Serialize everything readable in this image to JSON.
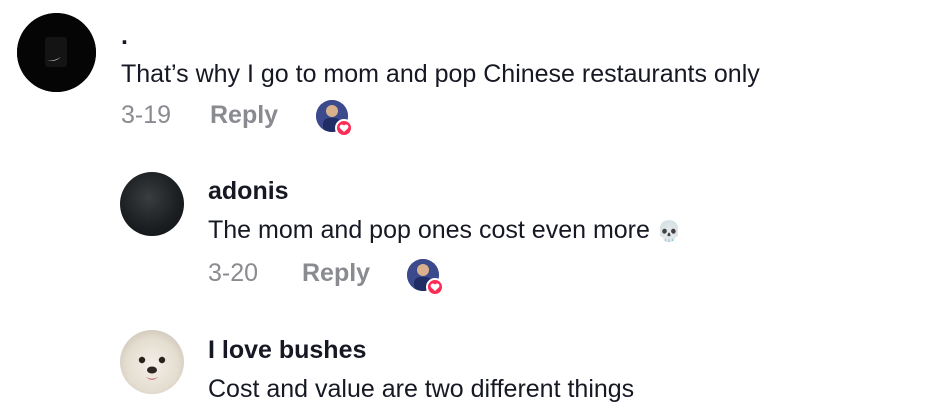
{
  "comments": [
    {
      "username": ".",
      "text": "That’s why I go to mom and pop Chinese restaurants only",
      "date": "3-19",
      "reply_label": "Reply"
    },
    {
      "username": "adonis",
      "text": "The mom and pop ones cost even more",
      "emoji": "💀",
      "date": "3-20",
      "reply_label": "Reply"
    },
    {
      "username": "I love bushes",
      "text": "Cost and value are two different things"
    }
  ],
  "colors": {
    "text": "#161823",
    "meta": "#8a8b91",
    "heart": "#fe2c55",
    "background": "#ffffff"
  },
  "icons": {
    "creator_like": "heart-icon",
    "skull": "skull-emoji"
  }
}
